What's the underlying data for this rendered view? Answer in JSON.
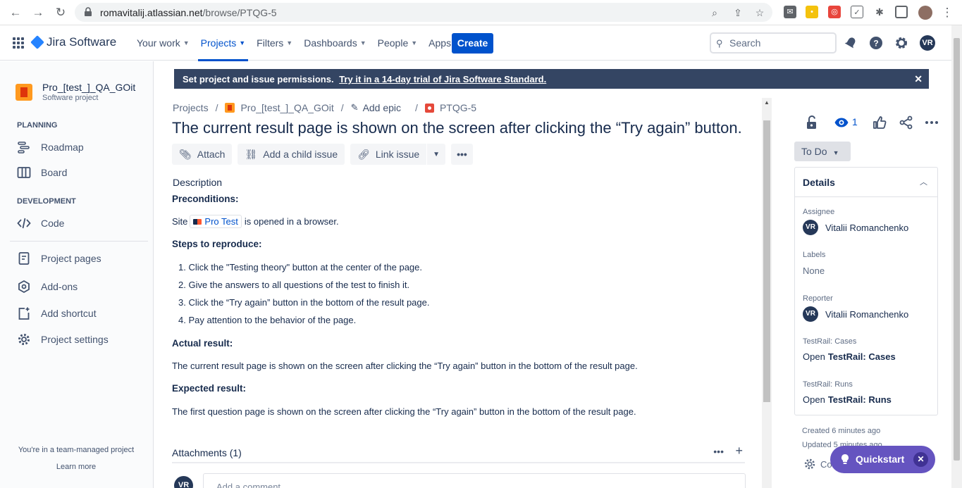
{
  "browser": {
    "url_host": "romavitalij.atlassian.net",
    "url_path": "/browse/PTQG-5"
  },
  "topnav": {
    "product": "Jira Software",
    "items": [
      {
        "label": "Your work",
        "active": false
      },
      {
        "label": "Projects",
        "active": true
      },
      {
        "label": "Filters",
        "active": false
      },
      {
        "label": "Dashboards",
        "active": false
      },
      {
        "label": "People",
        "active": false
      },
      {
        "label": "Apps",
        "active": false
      }
    ],
    "create_label": "Create",
    "search_placeholder": "Search",
    "user_initials": "VR"
  },
  "sidebar": {
    "project_name": "Pro_[test_]_QA_GOit",
    "project_type": "Software project",
    "planning_title": "PLANNING",
    "development_title": "DEVELOPMENT",
    "items": [
      {
        "label": "Roadmap"
      },
      {
        "label": "Board"
      },
      {
        "label": "Code"
      },
      {
        "label": "Project pages"
      },
      {
        "label": "Add-ons"
      },
      {
        "label": "Add shortcut"
      },
      {
        "label": "Project settings"
      }
    ],
    "footer_text": "You're in a team-managed project",
    "footer_link": "Learn more"
  },
  "banner": {
    "text": "Set project and issue permissions.",
    "link": "Try it in a 14-day trial of Jira Software Standard."
  },
  "breadcrumb": {
    "projects": "Projects",
    "project": "Pro_[test_]_QA_GOit",
    "epic": "Add epic",
    "issue_key": "PTQG-5"
  },
  "issue": {
    "title": "The current result page is shown on the screen after clicking the “Try again” button.",
    "toolbar": {
      "attach": "Attach",
      "add_child": "Add a child issue",
      "link_issue": "Link issue"
    },
    "description_label": "Description",
    "preconditions_heading": "Preconditions:",
    "precondition_prefix": "Site",
    "precondition_link": "Pro Test",
    "precondition_suffix": "is opened in a browser.",
    "steps_heading": "Steps to reproduce:",
    "steps": [
      "1. Click the \"Testing theory\" button at the center of the page.",
      "2. Give the answers to all questions of the test to finish it.",
      "3. Click the “Try again” button in the bottom of the result page.",
      "4. Pay attention to the behavior of the page."
    ],
    "actual_heading": "Actual result:",
    "actual_text": "The current result page is shown on the screen after clicking the “Try again” button in the bottom of the result page.",
    "expected_heading": "Expected result:",
    "expected_text": "The first question page is shown on the screen after clicking the “Try again” button in the bottom of the result page.",
    "attachments_label": "Attachments (1)",
    "comment_placeholder": "Add a comment...",
    "commenter_initials": "VR"
  },
  "right_panel": {
    "watch_count": "1",
    "status": "To Do",
    "details_title": "Details",
    "assignee_label": "Assignee",
    "assignee": "Vitalii Romanchenko",
    "assignee_initials": "VR",
    "labels_label": "Labels",
    "labels_value": "None",
    "reporter_label": "Reporter",
    "reporter": "Vitalii Romanchenko",
    "reporter_initials": "VR",
    "testrail_cases_label": "TestRail: Cases",
    "testrail_cases_prefix": "Open",
    "testrail_cases_value": "TestRail: Cases",
    "testrail_runs_label": "TestRail: Runs",
    "testrail_runs_prefix": "Open",
    "testrail_runs_value": "TestRail: Runs",
    "created": "Created 6 minutes ago",
    "updated": "Updated 5 minutes ago",
    "configure": "Co"
  },
  "quickstart": {
    "label": "Quickstart"
  }
}
